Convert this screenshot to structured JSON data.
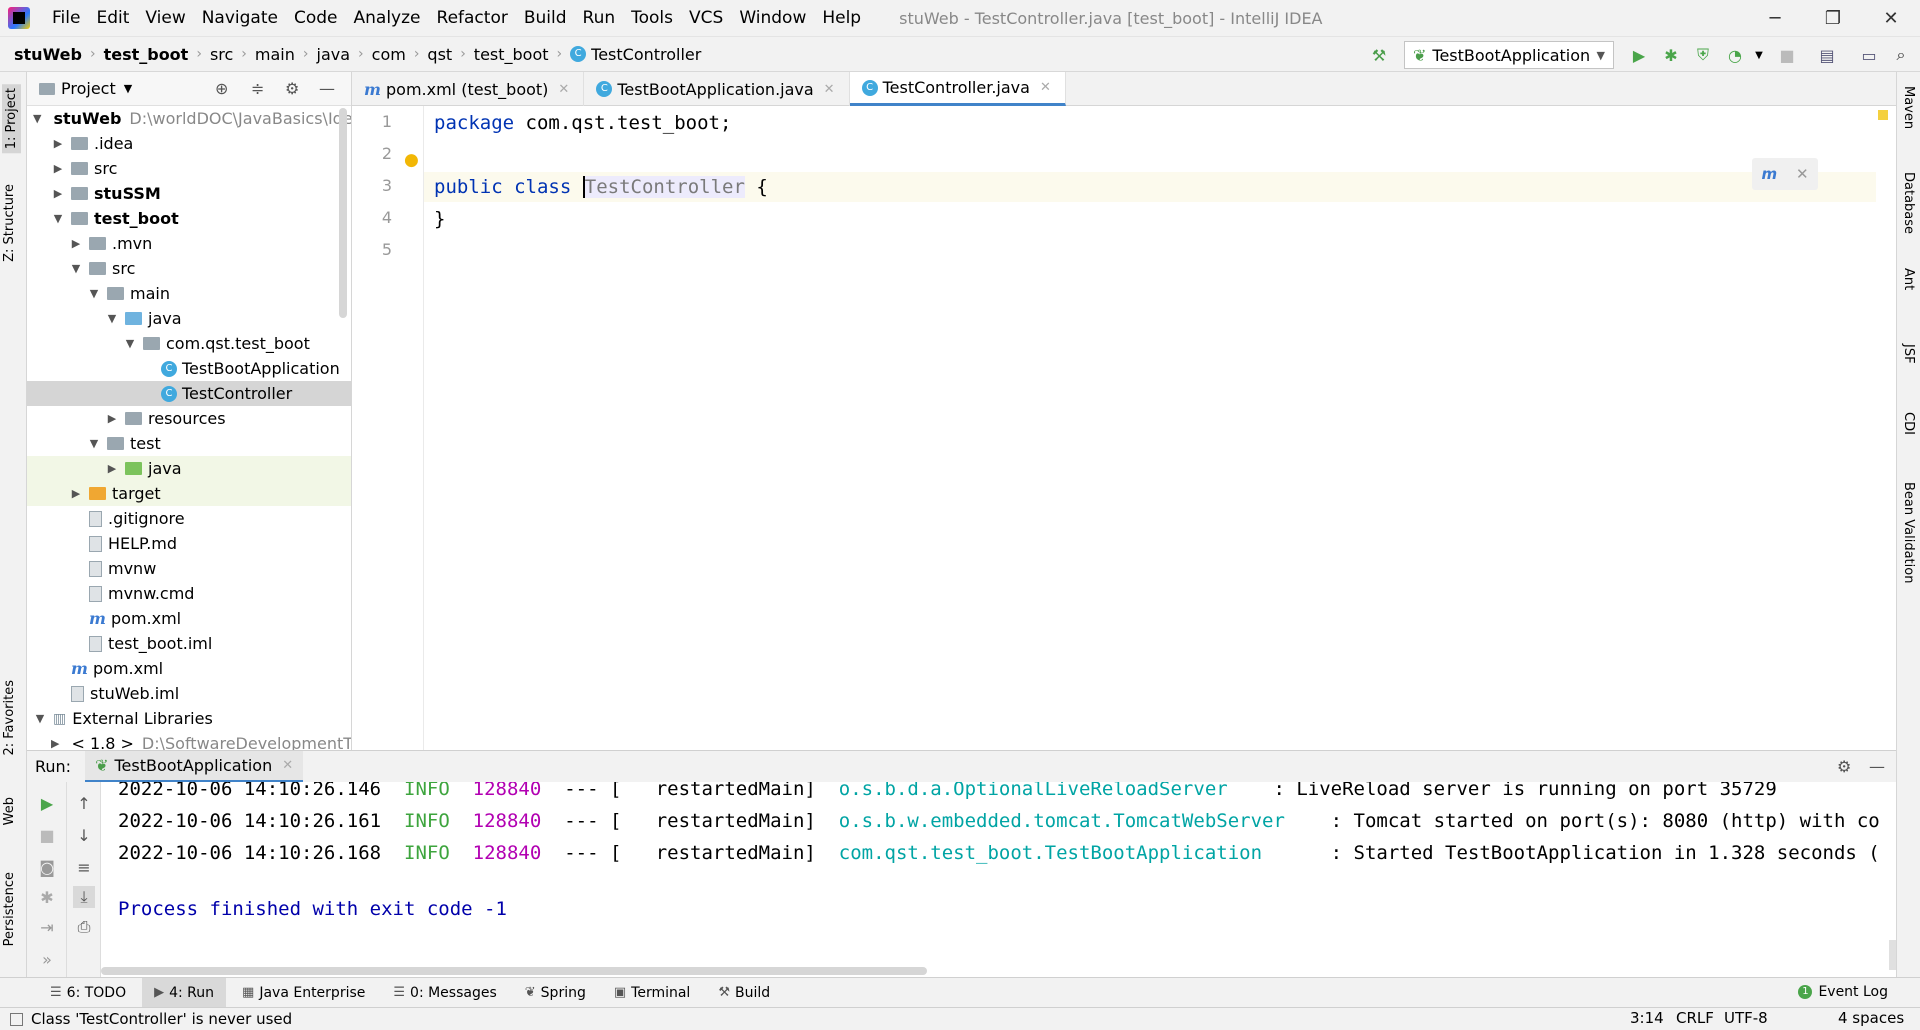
{
  "title_bar": {
    "menu": [
      "File",
      "Edit",
      "View",
      "Navigate",
      "Code",
      "Analyze",
      "Refactor",
      "Build",
      "Run",
      "Tools",
      "VCS",
      "Window",
      "Help"
    ],
    "window_title": "stuWeb - TestController.java [test_boot] - IntelliJ IDEA",
    "minimize": "─",
    "maximize": "❐",
    "close": "✕"
  },
  "breadcrumbs": [
    "stuWeb",
    "test_boot",
    "src",
    "main",
    "java",
    "com",
    "qst",
    "test_boot",
    "TestController"
  ],
  "run_config": "TestBootApplication",
  "left_tabs": [
    "1: Project",
    "Z: Structure",
    "2: Favorites",
    "Web",
    "Persistence"
  ],
  "right_tabs": [
    "Maven",
    "Database",
    "Ant",
    "JSF",
    "CDI",
    "Bean Validation"
  ],
  "project": {
    "header": "Project",
    "tree": [
      {
        "label": "stuWeb",
        "path": "D:\\worldDOC\\JavaBasics\\Idea",
        "depth": 0,
        "arrow": "▼",
        "icon": "folder",
        "bold": true
      },
      {
        "label": ".idea",
        "depth": 1,
        "arrow": "▶",
        "icon": "folder"
      },
      {
        "label": "src",
        "depth": 1,
        "arrow": "▶",
        "icon": "folder"
      },
      {
        "label": "stuSSM",
        "depth": 1,
        "arrow": "▶",
        "icon": "folder",
        "bold": true
      },
      {
        "label": "test_boot",
        "depth": 1,
        "arrow": "▼",
        "icon": "folder",
        "bold": true
      },
      {
        "label": ".mvn",
        "depth": 2,
        "arrow": "▶",
        "icon": "folder"
      },
      {
        "label": "src",
        "depth": 2,
        "arrow": "▼",
        "icon": "folder"
      },
      {
        "label": "main",
        "depth": 3,
        "arrow": "▼",
        "icon": "folder"
      },
      {
        "label": "java",
        "depth": 4,
        "arrow": "▼",
        "icon": "folder-blue"
      },
      {
        "label": "com.qst.test_boot",
        "depth": 5,
        "arrow": "▼",
        "icon": "package"
      },
      {
        "label": "TestBootApplication",
        "depth": 6,
        "arrow": "",
        "icon": "class"
      },
      {
        "label": "TestController",
        "depth": 6,
        "arrow": "",
        "icon": "class",
        "selected": true
      },
      {
        "label": "resources",
        "depth": 4,
        "arrow": "▶",
        "icon": "folder"
      },
      {
        "label": "test",
        "depth": 3,
        "arrow": "▼",
        "icon": "folder"
      },
      {
        "label": "java",
        "depth": 4,
        "arrow": "▶",
        "icon": "folder-green",
        "highlight": true
      },
      {
        "label": "target",
        "depth": 2,
        "arrow": "▶",
        "icon": "folder-orange",
        "highlight": true
      },
      {
        "label": ".gitignore",
        "depth": 2,
        "arrow": "",
        "icon": "file"
      },
      {
        "label": "HELP.md",
        "depth": 2,
        "arrow": "",
        "icon": "md"
      },
      {
        "label": "mvnw",
        "depth": 2,
        "arrow": "",
        "icon": "file"
      },
      {
        "label": "mvnw.cmd",
        "depth": 2,
        "arrow": "",
        "icon": "file"
      },
      {
        "label": "pom.xml",
        "depth": 2,
        "arrow": "",
        "icon": "maven"
      },
      {
        "label": "test_boot.iml",
        "depth": 2,
        "arrow": "",
        "icon": "file"
      },
      {
        "label": "pom.xml",
        "depth": 1,
        "arrow": "",
        "icon": "maven"
      },
      {
        "label": "stuWeb.iml",
        "depth": 1,
        "arrow": "",
        "icon": "file"
      },
      {
        "label": "External Libraries",
        "depth": 0,
        "arrow": "▼",
        "icon": "libs"
      },
      {
        "label": "< 1.8 >",
        "path": "D:\\SoftwareDevelopmentT",
        "depth": 1,
        "arrow": "▶",
        "icon": "folder"
      }
    ]
  },
  "editor": {
    "tabs": [
      {
        "label": "pom.xml (test_boot)",
        "icon": "maven"
      },
      {
        "label": "TestBootApplication.java",
        "icon": "class"
      },
      {
        "label": "TestController.java",
        "icon": "class",
        "active": true
      }
    ],
    "line_numbers": [
      "1",
      "2",
      "3",
      "4",
      "5"
    ],
    "code": {
      "l1_kw": "package",
      "l1_rest": " com.qst.test_boot;",
      "l3_kw1": "public",
      "l3_kw2": "class",
      "l3_name": "TestController",
      "l3_rest": " {",
      "l4": "}"
    }
  },
  "run": {
    "label": "Run:",
    "tab": "TestBootApplication",
    "logs": [
      {
        "ts": "2022-10-06 14:10:26.146",
        "level": "INFO",
        "pid": "128840",
        "sep": "--- [",
        "thread": " restartedMain]",
        "logger": "o.s.b.d.a.OptionalLiveReloadServer",
        "msg": "  : LiveReload server is running on port 35729"
      },
      {
        "ts": "2022-10-06 14:10:26.161",
        "level": "INFO",
        "pid": "128840",
        "sep": "--- [",
        "thread": " restartedMain]",
        "logger": "o.s.b.w.embedded.tomcat.TomcatWebServer",
        "msg": "  : Tomcat started on port(s): 8080 (http) with co"
      },
      {
        "ts": "2022-10-06 14:10:26.168",
        "level": "INFO",
        "pid": "128840",
        "sep": "--- [",
        "thread": " restartedMain]",
        "logger": "com.qst.test_boot.TestBootApplication",
        "msg": "    : Started TestBootApplication in 1.328 seconds ("
      }
    ],
    "exit": "Process finished with exit code -1"
  },
  "bottom_tabs": [
    {
      "label": "6: TODO",
      "icon": "☰"
    },
    {
      "label": "4: Run",
      "icon": "▶",
      "active": true
    },
    {
      "label": "Java Enterprise",
      "icon": "▦"
    },
    {
      "label": "0: Messages",
      "icon": "☰"
    },
    {
      "label": "Spring",
      "icon": "❦"
    },
    {
      "label": "Terminal",
      "icon": "▣"
    },
    {
      "label": "Build",
      "icon": "⚒"
    }
  ],
  "event_log": "Event Log",
  "status": {
    "message": "Class 'TestController' is never used",
    "position": "3:14",
    "line_sep": "CRLF",
    "encoding": "UTF-8",
    "indent": "4 spaces"
  }
}
